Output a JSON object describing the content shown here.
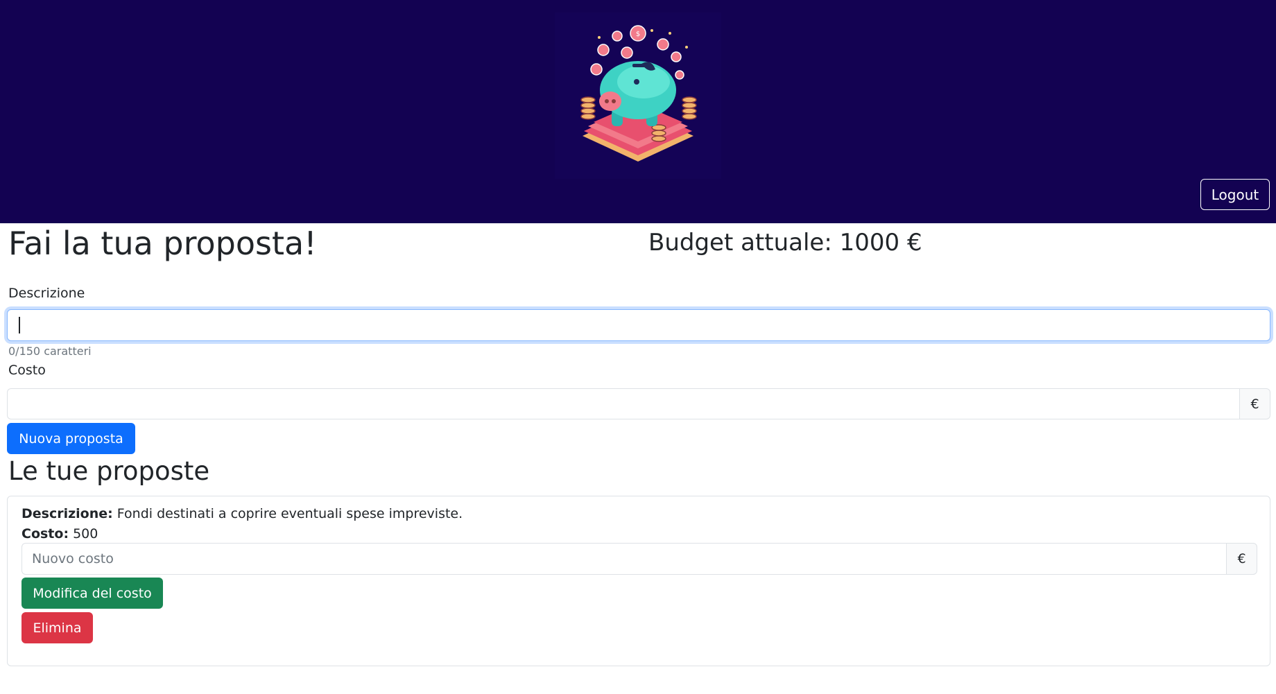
{
  "header": {
    "logo_icon": "piggy-bank-logo",
    "logout_label": "Logout",
    "background": "#130252"
  },
  "form": {
    "title": "Fai la tua proposta!",
    "budget_label": "Budget attuale:",
    "budget_value": "1000 €",
    "description_label": "Descrizione",
    "description_value": "",
    "char_count": "0/150 caratteri",
    "cost_label": "Costo",
    "cost_value": "",
    "currency_symbol": "€",
    "submit_label": "Nuova proposta"
  },
  "proposals": {
    "section_title": "Le tue proposte",
    "items": [
      {
        "description_label": "Descrizione:",
        "description": "Fondi destinati a coprire eventuali spese impreviste.",
        "cost_label": "Costo:",
        "cost": "500",
        "new_cost_placeholder": "Nuovo costo",
        "currency_symbol": "€",
        "edit_label": "Modifica del costo",
        "delete_label": "Elimina"
      }
    ]
  },
  "colors": {
    "primary": "#0d6efd",
    "success": "#198754",
    "danger": "#dc3545",
    "focus_border": "#86b7fe"
  }
}
